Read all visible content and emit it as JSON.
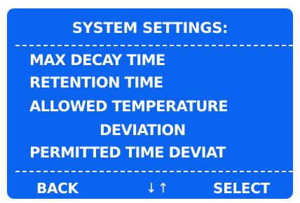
{
  "screen": {
    "title": "SYSTEM SETTINGS:",
    "background_color": "#0a64f0",
    "text_color": "#ffffff"
  },
  "menu": {
    "items": [
      {
        "label": "MAX DECAY TIME"
      },
      {
        "label": "RETENTION TIME"
      },
      {
        "label_line1": "ALLOWED TEMPERATURE",
        "label_line2": "DEVIATION"
      },
      {
        "label": "PERMITTED TIME DEVIAT"
      }
    ]
  },
  "softkeys": {
    "back": "BACK",
    "scroll_icon": "↓↑",
    "select": "SELECT"
  }
}
